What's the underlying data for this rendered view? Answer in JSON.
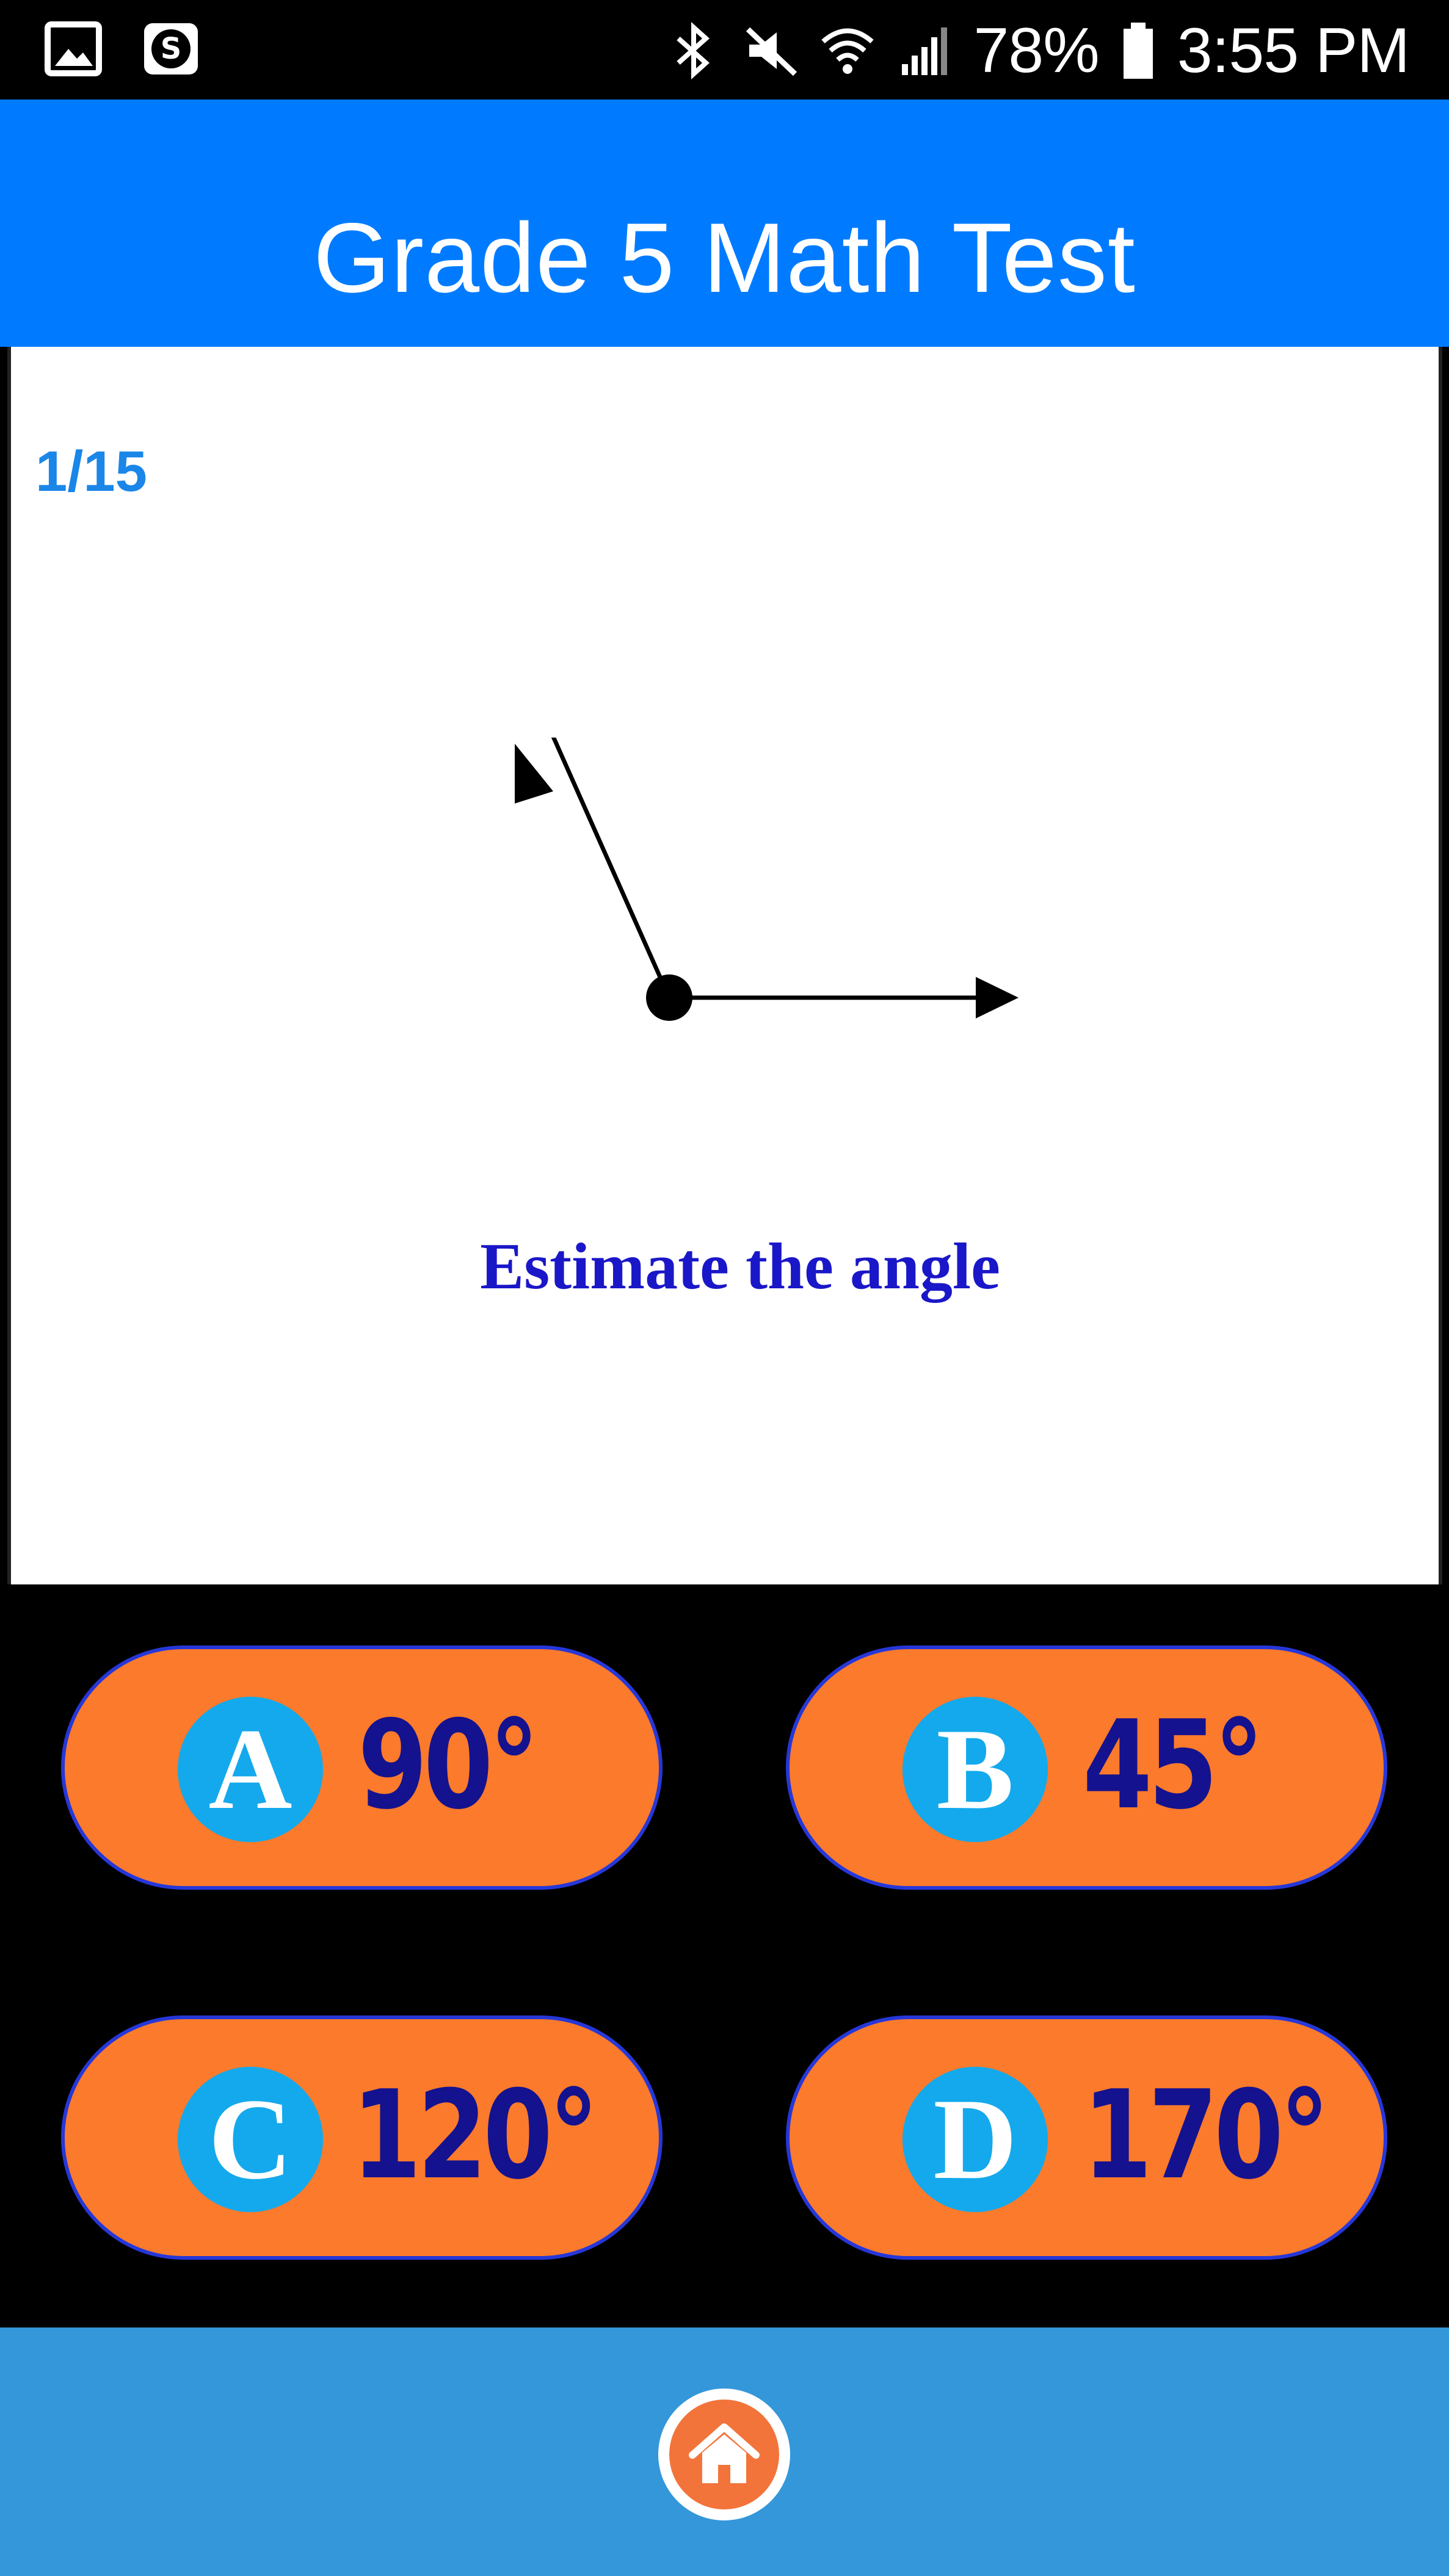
{
  "status_bar": {
    "left_icons": [
      "gallery-icon",
      "s-app-icon"
    ],
    "right_icons": [
      "bluetooth-icon",
      "mute-icon",
      "wifi-icon",
      "signal-icon",
      "battery-icon"
    ],
    "battery": "78%",
    "time": "3:55 PM"
  },
  "header": {
    "title": "Grade 5 Math Test"
  },
  "question": {
    "progress": "1/15",
    "prompt": "Estimate the angle",
    "figure": "angle-diagram"
  },
  "answers": [
    {
      "letter": "A",
      "value": "90°"
    },
    {
      "letter": "B",
      "value": "45°"
    },
    {
      "letter": "C",
      "value": "120°"
    },
    {
      "letter": "D",
      "value": "170°"
    }
  ],
  "footer": {
    "icon": "home-icon"
  },
  "colors": {
    "header_bg": "#007bff",
    "answer_bg": "#fb7a2b",
    "letter_circle": "#14a9ec",
    "answer_text": "#14128e",
    "prompt_text": "#1a17c8",
    "progress_text": "#1a86e8",
    "footer_bg": "#3497da",
    "home_icon": "#f2743a"
  }
}
